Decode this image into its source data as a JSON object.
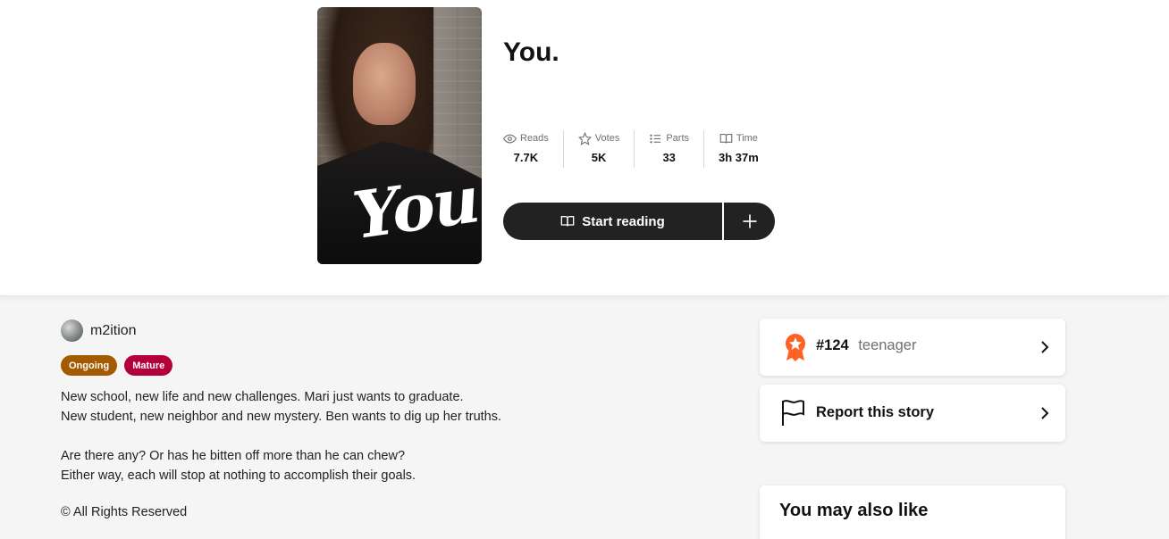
{
  "story": {
    "title": "You.",
    "cover_text": "You."
  },
  "stats": [
    {
      "label": "Reads",
      "value": "7.7K",
      "icon": "eye-icon"
    },
    {
      "label": "Votes",
      "value": "5K",
      "icon": "star-icon"
    },
    {
      "label": "Parts",
      "value": "33",
      "icon": "list-icon"
    },
    {
      "label": "Time",
      "value": "3h 37m",
      "icon": "book-open-icon"
    }
  ],
  "actions": {
    "start_reading": "Start reading",
    "add_icon": "plus-icon"
  },
  "author": {
    "name": "m2ition"
  },
  "badges": {
    "ongoing": "Ongoing",
    "mature": "Mature"
  },
  "description": {
    "line1": "New school, new life and new challenges. Mari just wants to graduate.",
    "line2": "New student, new neighbor and new mystery. Ben wants to dig up her truths.",
    "line3": "Are there any? Or has he bitten off more than he can chew?",
    "line4": "Either way, each will stop at nothing to accomplish their goals."
  },
  "copyright": "© All Rights Reserved",
  "sidebar": {
    "rank_number": "#124",
    "rank_tag": "teenager",
    "report_label": "Report this story",
    "also_like_title": "You may also like"
  },
  "colors": {
    "dark_button": "#222222",
    "ongoing_badge": "#a35a00",
    "mature_badge": "#b3003b",
    "rank_badge": "#ff6122"
  }
}
